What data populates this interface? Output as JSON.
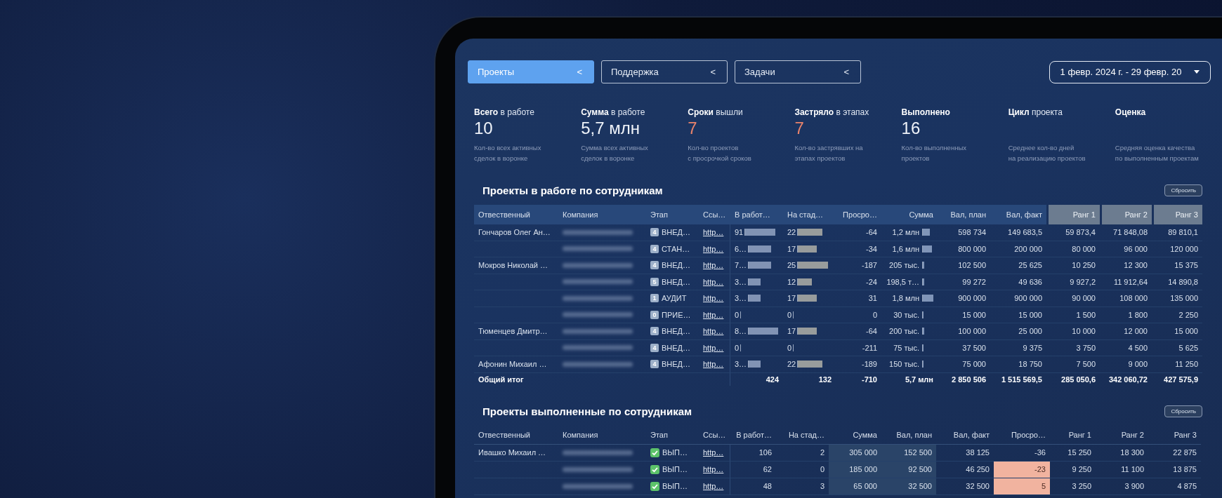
{
  "filters": [
    {
      "label": "Проекты",
      "arrow": "<",
      "selected": true
    },
    {
      "label": "Поддержка",
      "arrow": "<",
      "selected": false
    },
    {
      "label": "Задачи",
      "arrow": "<",
      "selected": false
    }
  ],
  "date_range": {
    "value": "1 февр. 2024 г. - 29 февр. 20"
  },
  "kpis": [
    {
      "title": "**Всего** в работе",
      "value": "10",
      "alert": false,
      "description": [
        "Кол-во всех активных",
        "сделок в воронке"
      ]
    },
    {
      "title": "**Сумма** в работе",
      "value": "5,7 млн",
      "alert": false,
      "description": [
        "Сумма всех активных",
        "сделок в воронке"
      ]
    },
    {
      "title": "**Сроки** вышли",
      "value": "7",
      "alert": true,
      "description": [
        "Кол-во проектов",
        "с просрочкой сроков"
      ]
    },
    {
      "title": "**Застряло** в этапах",
      "value": "7",
      "alert": true,
      "description": [
        "Кол-во застрявших на",
        "этапах проектов"
      ]
    },
    {
      "title": "**Выполнено**",
      "value": "16",
      "alert": false,
      "description": [
        "Кол-во выполненных",
        "проектов"
      ]
    },
    {
      "title": "**Цикл** проекта",
      "description": [
        "Среднее кол-во дней",
        "на реализацию проектов"
      ]
    },
    {
      "title": "**Оценка**",
      "description": [
        "Средняя оценка качества",
        "по выполненным проектам"
      ]
    }
  ],
  "sections": [
    {
      "kind": "in_progress",
      "title": "Проекты в работе по сотрудникам",
      "reset_button": "Сбросить",
      "columns": [
        {
          "label": "Отвественный",
          "highlighted": false
        },
        {
          "label": "Компания",
          "highlighted": false
        },
        {
          "label": "Этап",
          "highlighted": false
        },
        {
          "label": "Ссы…",
          "highlighted": false
        },
        {
          "label": "В работ…",
          "highlighted": false
        },
        {
          "label": "На стад…",
          "highlighted": false
        },
        {
          "label": "Просро…",
          "highlighted": false
        },
        {
          "label": "Сумма",
          "highlighted": false
        },
        {
          "label": "Вал, план",
          "highlighted": false
        },
        {
          "label": "Вал, факт",
          "highlighted": false
        },
        {
          "label": "Ранг 1",
          "highlighted": true
        },
        {
          "label": "Ранг 2",
          "highlighted": true
        },
        {
          "label": "Ранг 3",
          "highlighted": true
        }
      ],
      "rows": [
        {
          "responsible": "Гончаров Олег Ан…",
          "stage": {
            "kind": "number",
            "badge": "4",
            "label": "ВНЕД…"
          },
          "link": "http…",
          "in_work": {
            "value": "91",
            "level": 1
          },
          "on_stage": {
            "value": "22",
            "level": 0.8
          },
          "overdue": "-64",
          "sum": {
            "value": "1,2 млн",
            "level": 0.67
          },
          "plan": "598 734",
          "fact": "149 683,5",
          "ranks": [
            "59 873,4",
            "71 848,08",
            "89 810,1"
          ]
        },
        {
          "stage": {
            "kind": "number",
            "badge": "4",
            "label": "СТАН…"
          },
          "link": "http…",
          "in_work": {
            "value": "6…",
            "level": 0.73
          },
          "on_stage": {
            "value": "17",
            "level": 0.62
          },
          "overdue": "-34",
          "sum": {
            "value": "1,6 млн",
            "level": 0.89
          },
          "plan": "800 000",
          "fact": "200 000",
          "ranks": [
            "80 000",
            "96 000",
            "120 000"
          ]
        },
        {
          "responsible": "Мокров Николай …",
          "stage": {
            "kind": "number",
            "badge": "4",
            "label": "ВНЕД…"
          },
          "link": "http…",
          "in_work": {
            "value": "7…",
            "level": 0.73
          },
          "on_stage": {
            "value": "25",
            "level": 1
          },
          "overdue": "-187",
          "sum": {
            "value": "205 тыс.",
            "level": 0.11
          },
          "plan": "102 500",
          "fact": "25 625",
          "ranks": [
            "10 250",
            "12 300",
            "15 375"
          ]
        },
        {
          "stage": {
            "kind": "number",
            "badge": "5",
            "label": "ВНЕД…"
          },
          "link": "http…",
          "in_work": {
            "value": "3…",
            "level": 0.4
          },
          "on_stage": {
            "value": "12",
            "level": 0.45
          },
          "overdue": "-24",
          "sum": {
            "value": "198,5 т…",
            "level": 0.11
          },
          "plan": "99 272",
          "fact": "49 636",
          "ranks": [
            "9 927,2",
            "11 912,64",
            "14 890,8"
          ]
        },
        {
          "stage": {
            "kind": "number",
            "badge": "1",
            "label": "АУДИТ"
          },
          "link": "http…",
          "in_work": {
            "value": "3…",
            "level": 0.4
          },
          "on_stage": {
            "value": "17",
            "level": 0.62
          },
          "overdue": "31",
          "sum": {
            "value": "1,8 млн",
            "level": 1
          },
          "plan": "900 000",
          "fact": "900 000",
          "ranks": [
            "90 000",
            "108 000",
            "135 000"
          ]
        },
        {
          "stage": {
            "kind": "number",
            "badge": "0",
            "label": "ПРИЕ…"
          },
          "link": "http…",
          "in_work": {
            "value": "0",
            "level": 0
          },
          "on_stage": {
            "value": "0",
            "level": 0
          },
          "overdue": "0",
          "sum": {
            "value": "30 тыс.",
            "level": 0.02
          },
          "plan": "15 000",
          "fact": "15 000",
          "ranks": [
            "1 500",
            "1 800",
            "2 250"
          ]
        },
        {
          "responsible": "Тюменцев Дмитр…",
          "stage": {
            "kind": "number",
            "badge": "4",
            "label": "ВНЕД…"
          },
          "link": "http…",
          "in_work": {
            "value": "8…",
            "level": 0.98
          },
          "on_stage": {
            "value": "17",
            "level": 0.62
          },
          "overdue": "-64",
          "sum": {
            "value": "200 тыс.",
            "level": 0.11
          },
          "plan": "100 000",
          "fact": "25 000",
          "ranks": [
            "10 000",
            "12 000",
            "15 000"
          ]
        },
        {
          "stage": {
            "kind": "number",
            "badge": "4",
            "label": "ВНЕД…"
          },
          "link": "http…",
          "in_work": {
            "value": "0",
            "level": 0
          },
          "on_stage": {
            "value": "0",
            "level": 0
          },
          "overdue": "-211",
          "sum": {
            "value": "75 тыс.",
            "level": 0.04
          },
          "plan": "37 500",
          "fact": "9 375",
          "ranks": [
            "3 750",
            "4 500",
            "5 625"
          ]
        },
        {
          "responsible": "Афонин Михаил …",
          "stage": {
            "kind": "number",
            "badge": "4",
            "label": "ВНЕД…"
          },
          "link": "http…",
          "in_work": {
            "value": "3…",
            "level": 0.4
          },
          "on_stage": {
            "value": "22",
            "level": 0.8
          },
          "overdue": "-189",
          "sum": {
            "value": "150 тыс.",
            "level": 0.08
          },
          "plan": "75 000",
          "fact": "18 750",
          "ranks": [
            "7 500",
            "9 000",
            "11 250"
          ]
        }
      ],
      "totals": {
        "label": "Общий итог",
        "values": [
          "424",
          "132",
          "-710",
          "5,7 млн",
          "2 850 506",
          "1 515 569,5",
          "285 050,6",
          "342 060,72",
          "427 575,9"
        ]
      }
    },
    {
      "kind": "completed",
      "title": "Проекты выполненные по сотрудникам",
      "reset_button": "Сбросить",
      "columns": [
        {
          "label": "Отвественный"
        },
        {
          "label": "Компания"
        },
        {
          "label": "Этап"
        },
        {
          "label": "Ссы…"
        },
        {
          "label": "В работ…"
        },
        {
          "label": "На стад…"
        },
        {
          "label": "Сумма",
          "shaded": true
        },
        {
          "label": "Вал, план",
          "shaded": true
        },
        {
          "label": "Вал, факт"
        },
        {
          "label": "Просро…"
        },
        {
          "label": "Ранг 1"
        },
        {
          "label": "Ранг 2"
        },
        {
          "label": "Ранг 3"
        }
      ],
      "rows": [
        {
          "responsible": "Ивашко Михаил …",
          "stage": {
            "kind": "done",
            "label": "ВЫП…"
          },
          "link": "http…",
          "in_work": "106",
          "on_stage": "2",
          "sum": "305 000",
          "plan": "152 500",
          "fact": "38 125",
          "overdue": "-36",
          "overdue_flag": false,
          "ranks": [
            "15 250",
            "18 300",
            "22 875"
          ]
        },
        {
          "stage": {
            "kind": "done",
            "label": "ВЫП…"
          },
          "link": "http…",
          "in_work": "62",
          "on_stage": "0",
          "sum": "185 000",
          "plan": "92 500",
          "fact": "46 250",
          "overdue": "-23",
          "overdue_flag": true,
          "ranks": [
            "9 250",
            "11 100",
            "13 875"
          ]
        },
        {
          "stage": {
            "kind": "done",
            "label": "ВЫП…"
          },
          "link": "http…",
          "in_work": "48",
          "on_stage": "3",
          "sum": "65 000",
          "plan": "32 500",
          "fact": "32 500",
          "overdue": "5",
          "overdue_flag": true,
          "ranks": [
            "3 250",
            "3 900",
            "4 875"
          ]
        }
      ]
    }
  ]
}
